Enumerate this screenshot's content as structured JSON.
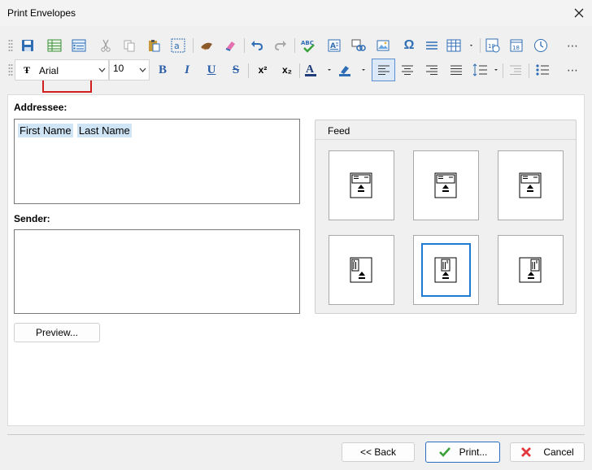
{
  "window": {
    "title": "Print Envelopes"
  },
  "toolbar": {
    "font_name": "Arial",
    "font_size": "10",
    "bold": "B",
    "italic": "I",
    "underline": "U",
    "strike": "S",
    "superscript": "x²",
    "subscript": "x₂",
    "font_color": "A",
    "spell": "ABC",
    "omega": "Ω",
    "date_day": "18",
    "overflow": "⋯"
  },
  "addressee": {
    "label": "Addressee:",
    "tokens": [
      "First Name",
      "Last Name"
    ]
  },
  "sender": {
    "label": "Sender:",
    "value": ""
  },
  "preview_button": "Preview...",
  "feed": {
    "label": "Feed",
    "selected_index": 4,
    "options": [
      "feed-option-1",
      "feed-option-2",
      "feed-option-3",
      "feed-option-4",
      "feed-option-5",
      "feed-option-6"
    ]
  },
  "footer": {
    "back_label": "<< Back",
    "print_label": "Print...",
    "cancel_label": "Cancel"
  },
  "colors": {
    "accent": "#1f7bd2",
    "highlight_box": "#d11f1f",
    "token_bg": "#cfe4f5",
    "print_check": "#3aa03a",
    "cancel_x": "#e0393e"
  },
  "icons": {
    "toolbar_row1": [
      "save-icon",
      "table-view-icon",
      "list-view-icon",
      "cut-icon",
      "copy-icon",
      "paste-icon",
      "find-icon",
      "format-painter-icon",
      "clear-format-icon",
      "undo-icon",
      "redo-icon",
      "spellcheck-icon",
      "text-box-icon",
      "link-icon",
      "image-icon",
      "symbol-icon",
      "horizontal-line-icon",
      "table-icon",
      "date-icon",
      "calendar-icon",
      "clock-icon",
      "overflow-icon"
    ],
    "toolbar_row2": [
      "font-icon",
      "bold-icon",
      "italic-icon",
      "underline-icon",
      "strikethrough-icon",
      "superscript-icon",
      "subscript-icon",
      "font-color-icon",
      "highlight-icon",
      "align-left-icon",
      "align-center-icon",
      "align-right-icon",
      "justify-icon",
      "line-spacing-icon",
      "indent-icon",
      "bullets-icon",
      "overflow-icon"
    ]
  }
}
